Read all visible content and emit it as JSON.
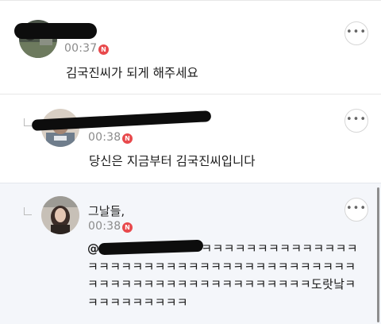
{
  "comments": [
    {
      "author": "",
      "time": "00:37",
      "new_badge": "N",
      "text": "김국진씨가 되게 해주세요",
      "more_icon": "more-horizontal-icon"
    },
    {
      "author": "",
      "time": "00:38",
      "new_badge": "N",
      "text": "당신은 지금부터 김국진씨입니다",
      "more_icon": "more-horizontal-icon"
    },
    {
      "author": "그날들,",
      "time": "00:38",
      "new_badge": "N",
      "mention": "@@",
      "text": "ㅅㅂㅋㅋㅋㅋㅋㅋㅋㅋㅋㅋㅋㅋㅋㅋㅋㅋㅋㅋㅋㅋㅋㅋㅋㅋㅋㅋㅋㅋㅋㅋㅋㅋㅋㅋㅋㅋㅋㅋㅋㅋㅋㅋㅋㅋㅋㅋㅋㅋㅋㅋㅋㅋㅋㅋㅋㅋㅋㅋㅋㅋㅋㅋㅋㅋ도랏낰ㅋㅋㅋㅋㅋㅋㅋㅋㅋㅋ",
      "more_icon": "more-horizontal-icon"
    }
  ],
  "colors": {
    "badge": "#e8494c",
    "highlight_bg": "#f4f6fa",
    "time": "#8b8b8b"
  }
}
